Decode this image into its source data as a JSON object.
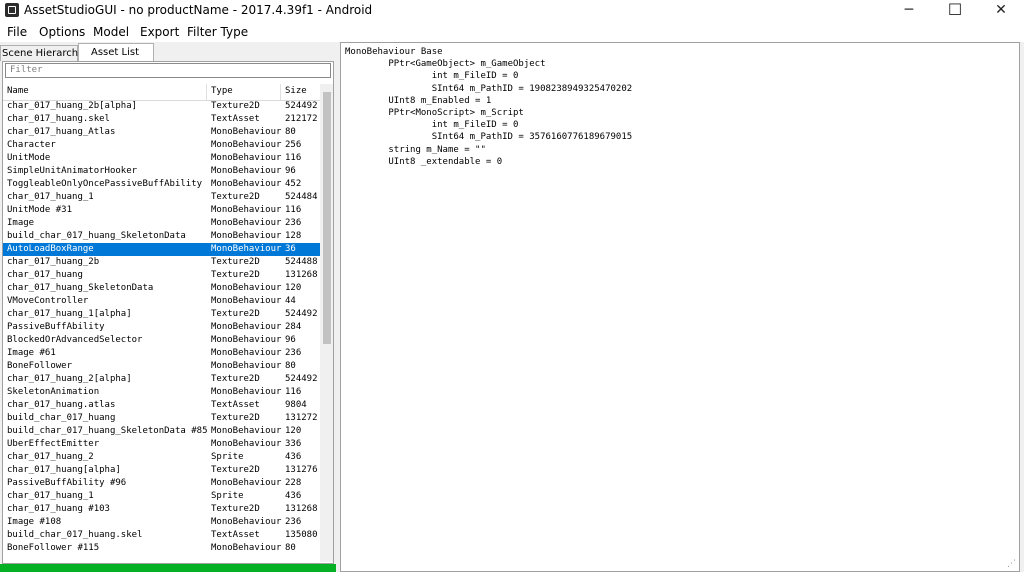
{
  "window": {
    "title": "AssetStudioGUI - no productName - 2017.4.39f1 - Android",
    "min_glyph": "─",
    "max_glyph": "☐",
    "close_glyph": "✕"
  },
  "menu": [
    "File",
    "Options",
    "Model",
    "Export",
    "Filter Type"
  ],
  "tabs": {
    "scene_hierarchy": "Scene Hierarchy",
    "asset_list": "Asset List"
  },
  "filter": {
    "placeholder": "Filter"
  },
  "columns": {
    "name": "Name",
    "type": "Type",
    "size": "Size"
  },
  "assets": [
    {
      "name": "char_017_huang_2b[alpha]",
      "type": "Texture2D",
      "size": "524492"
    },
    {
      "name": "char_017_huang.skel",
      "type": "TextAsset",
      "size": "212172"
    },
    {
      "name": "char_017_huang_Atlas",
      "type": "MonoBehaviour",
      "size": "80"
    },
    {
      "name": "Character",
      "type": "MonoBehaviour",
      "size": "256"
    },
    {
      "name": "UnitMode",
      "type": "MonoBehaviour",
      "size": "116"
    },
    {
      "name": "SimpleUnitAnimatorHooker",
      "type": "MonoBehaviour",
      "size": "96"
    },
    {
      "name": "ToggleableOnlyOncePassiveBuffAbility",
      "type": "MonoBehaviour",
      "size": "452"
    },
    {
      "name": "char_017_huang_1",
      "type": "Texture2D",
      "size": "524484"
    },
    {
      "name": "UnitMode #31",
      "type": "MonoBehaviour",
      "size": "116"
    },
    {
      "name": "Image",
      "type": "MonoBehaviour",
      "size": "236"
    },
    {
      "name": "build_char_017_huang_SkeletonData",
      "type": "MonoBehaviour",
      "size": "128"
    },
    {
      "name": "AutoLoadBoxRange",
      "type": "MonoBehaviour",
      "size": "36",
      "selected": true
    },
    {
      "name": "char_017_huang_2b",
      "type": "Texture2D",
      "size": "524488"
    },
    {
      "name": "char_017_huang",
      "type": "Texture2D",
      "size": "131268"
    },
    {
      "name": "char_017_huang_SkeletonData",
      "type": "MonoBehaviour",
      "size": "120"
    },
    {
      "name": "VMoveController",
      "type": "MonoBehaviour",
      "size": "44"
    },
    {
      "name": "char_017_huang_1[alpha]",
      "type": "Texture2D",
      "size": "524492"
    },
    {
      "name": "PassiveBuffAbility",
      "type": "MonoBehaviour",
      "size": "284"
    },
    {
      "name": "BlockedOrAdvancedSelector",
      "type": "MonoBehaviour",
      "size": "96"
    },
    {
      "name": "Image #61",
      "type": "MonoBehaviour",
      "size": "236"
    },
    {
      "name": "BoneFollower",
      "type": "MonoBehaviour",
      "size": "80"
    },
    {
      "name": "char_017_huang_2[alpha]",
      "type": "Texture2D",
      "size": "524492"
    },
    {
      "name": "SkeletonAnimation",
      "type": "MonoBehaviour",
      "size": "116"
    },
    {
      "name": "char_017_huang.atlas",
      "type": "TextAsset",
      "size": "9804"
    },
    {
      "name": "build_char_017_huang",
      "type": "Texture2D",
      "size": "131272"
    },
    {
      "name": "build_char_017_huang_SkeletonData #85",
      "type": "MonoBehaviour",
      "size": "120"
    },
    {
      "name": "UberEffectEmitter",
      "type": "MonoBehaviour",
      "size": "336"
    },
    {
      "name": "char_017_huang_2",
      "type": "Sprite",
      "size": "436"
    },
    {
      "name": "char_017_huang[alpha]",
      "type": "Texture2D",
      "size": "131276"
    },
    {
      "name": "PassiveBuffAbility #96",
      "type": "MonoBehaviour",
      "size": "228"
    },
    {
      "name": "char_017_huang_1",
      "type": "Sprite",
      "size": "436"
    },
    {
      "name": "char_017_huang #103",
      "type": "Texture2D",
      "size": "131268"
    },
    {
      "name": "Image #108",
      "type": "MonoBehaviour",
      "size": "236"
    },
    {
      "name": "build_char_017_huang.skel",
      "type": "TextAsset",
      "size": "135080"
    },
    {
      "name": "BoneFollower #115",
      "type": "MonoBehaviour",
      "size": "80"
    }
  ],
  "progress": {
    "percent": 100,
    "color": "#06b025"
  },
  "dump": {
    "text": "MonoBehaviour Base\n\tPPtr<GameObject> m_GameObject\n\t\tint m_FileID = 0\n\t\tSInt64 m_PathID = 1908238949325470202\n\tUInt8 m_Enabled = 1\n\tPPtr<MonoScript> m_Script\n\t\tint m_FileID = 0\n\t\tSInt64 m_PathID = 3576160776189679015\n\tstring m_Name = \"\"\n\tUInt8 _extendable = 0"
  },
  "colors": {
    "selection": "#0078d7",
    "accent_progress": "#06b025"
  }
}
